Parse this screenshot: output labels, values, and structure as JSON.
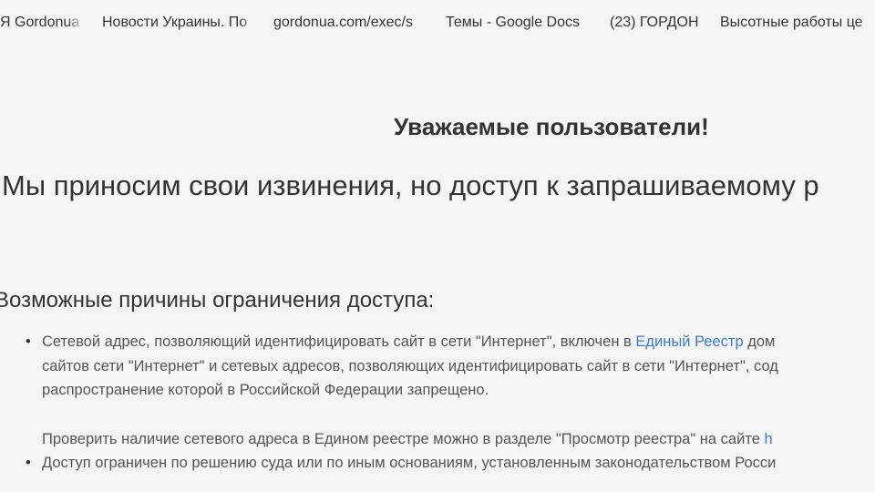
{
  "bookmarks": [
    {
      "label": "Я Gordonua"
    },
    {
      "label": "Новости Украины. По"
    },
    {
      "label": "gordonua.com/exec/s"
    },
    {
      "label": "Темы - Google Docs"
    },
    {
      "label": "(23) ГОРДОН"
    },
    {
      "label": "Высотные работы це"
    }
  ],
  "page": {
    "greeting": "Уважаемые пользователи!",
    "apology": "Мы приносим свои извинения, но доступ к запрашиваемому р",
    "reasons_title": "Возможные причины ограничения доступа:",
    "reason1": {
      "line1_pre": "Сетевой адрес, позволяющий идентифицировать сайт в сети \"Интернет\", включен в ",
      "line1_link": "Единый Реестр",
      "line1_post": " дом",
      "line2": "сайтов сети \"Интернет\" и сетевых адресов, позволяющих идентифицировать сайт в сети \"Интернет\", сод",
      "line3": "распространение которой в Российской Федерации запрещено.",
      "line4_pre": "Проверить наличие сетевого адреса в Едином реестре можно в разделе \"Просмотр реестра\" на сайте ",
      "line4_link": "h"
    },
    "reason2": "Доступ ограничен по решению суда или по иным основаниям, установленным законодательством Росси"
  },
  "colors": {
    "background": "#f5f5f5",
    "text": "#333333",
    "link": "#3a7bd5"
  }
}
